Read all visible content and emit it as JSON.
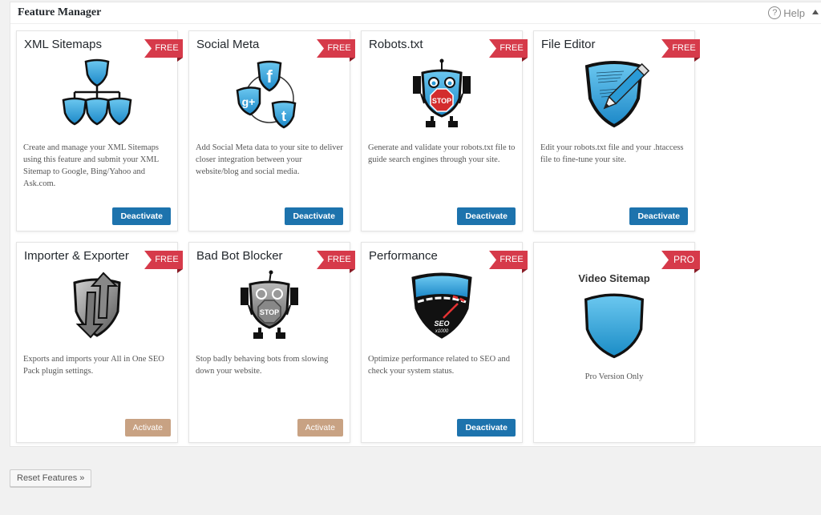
{
  "panel": {
    "title": "Feature Manager",
    "help_label": "Help",
    "help_icon": "question-circle-icon",
    "collapse_icon": "triangle-up-icon"
  },
  "colors": {
    "ribbon": "#d63a4a",
    "deactivate_button": "#1d73ad",
    "activate_button": "#c8a283",
    "icon_blue": "#2a9ad6"
  },
  "features": [
    {
      "title": "XML Sitemaps",
      "badge": "FREE",
      "icon": "sitemap-shields-icon",
      "description": "Create and manage your XML Sitemaps using this feature and submit your XML Sitemap to Google, Bing/Yahoo and Ask.com.",
      "button": "Deactivate",
      "active": true
    },
    {
      "title": "Social Meta",
      "badge": "FREE",
      "icon": "social-shields-icon",
      "description": "Add Social Meta data to your site to deliver closer integration between your website/blog and social media.",
      "button": "Deactivate",
      "active": true
    },
    {
      "title": "Robots.txt",
      "badge": "FREE",
      "icon": "robot-stop-icon",
      "description": "Generate and validate your robots.txt file to guide search engines through your site.",
      "button": "Deactivate",
      "active": true
    },
    {
      "title": "File Editor",
      "badge": "FREE",
      "icon": "shield-pencil-icon",
      "description": "Edit your robots.txt file and your .htaccess file to fine-tune your site.",
      "button": "Deactivate",
      "active": true
    },
    {
      "title": "Importer & Exporter",
      "badge": "FREE",
      "icon": "import-export-arrows-icon",
      "description": "Exports and imports your All in One SEO Pack plugin settings.",
      "button": "Activate",
      "active": false
    },
    {
      "title": "Bad Bot Blocker",
      "badge": "FREE",
      "icon": "bad-bot-stop-icon",
      "description": "Stop badly behaving bots from slowing down your website.",
      "button": "Activate",
      "active": false
    },
    {
      "title": "Performance",
      "badge": "FREE",
      "icon": "speedometer-shield-icon",
      "description": "Optimize performance related to SEO and check your system status.",
      "button": "Deactivate",
      "active": true,
      "gauge_text": "SEO",
      "gauge_subtext": "x1000"
    }
  ],
  "pro_feature": {
    "title": "Video Sitemap",
    "badge": "PRO",
    "icon": "shield-icon",
    "note": "Pro Version Only"
  },
  "stop_sign_text": "STOP",
  "reset_button": "Reset Features »"
}
